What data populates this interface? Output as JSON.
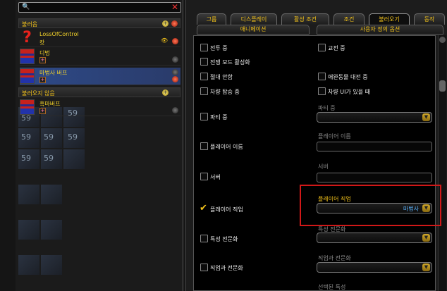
{
  "search": {
    "value": ""
  },
  "left": {
    "group1_title": "불러옴",
    "group2_title": "불러오지 않음",
    "rows": [
      {
        "name": "LossOfControl",
        "sub": "캇"
      },
      {
        "name": "디법",
        "sub": "+"
      },
      {
        "name": "마법사 버프",
        "sub": "+"
      },
      {
        "name": "흑마버프",
        "sub": "+"
      }
    ],
    "bg_labels": [
      "59",
      "59",
      "59",
      "59",
      "59",
      "59",
      "59",
      "59"
    ]
  },
  "tabs": [
    "그룹",
    "디스플레이",
    "활성 조건",
    "조건",
    "불러오기",
    "동작"
  ],
  "subtabs": [
    "애니메이션",
    "사용자 정의 옵션"
  ],
  "options": {
    "combat": "전투 중",
    "encounter": "교전 중",
    "warmode": "전쟁 모드 활성화",
    "never": "절대 안함",
    "petbattle": "애완동물 대전 중",
    "mounted": "차량 탑승 중",
    "vehicle_ui": "차량 UI가 있을 때",
    "party": "파티 중",
    "party_lbl": "파티 중",
    "playername": "플레이어 이름",
    "playername_lbl": "플레이어 이름",
    "server": "서버",
    "server_lbl": "서버",
    "playerclass": "플레이어 직업",
    "playerclass_lbl": "플레이어 직업",
    "playerclass_val": "마법사",
    "spec": "특성 전문화",
    "spec_lbl": "특성 전문화",
    "classspec": "직업과 전문화",
    "classspec_lbl": "직업과 전문화",
    "selspec_lbl": "선택된 특성"
  },
  "colors": {
    "accent": "#f2c21a",
    "highlight": "#d11818",
    "value": "#5ab4ff"
  }
}
